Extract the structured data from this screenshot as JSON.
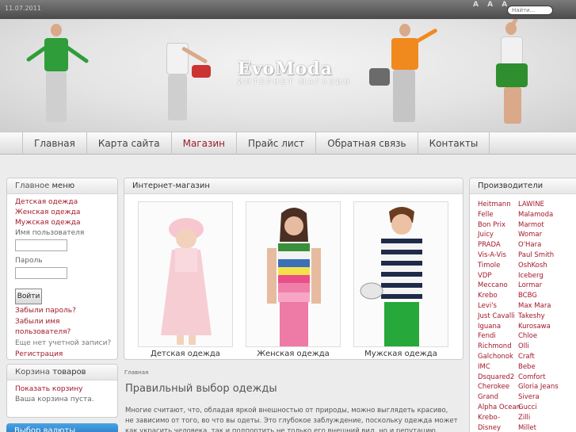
{
  "topbar": {
    "date": "11.07.2011",
    "font_sizes": "A A A",
    "search_placeholder": "Найти..."
  },
  "logo": {
    "line1": "EvoModa",
    "line2": "ИНТЕРНЕТ МАГАЗИН"
  },
  "nav": {
    "items": [
      "Главная",
      "Карта сайта",
      "Магазин",
      "Прайс лист",
      "Обратная связь",
      "Контакты"
    ],
    "active_index": 2
  },
  "main_menu": {
    "title_light": "Главное",
    "title_bold": "меню",
    "links": [
      "Детская одежда",
      "Женская одежда",
      "Мужская одежда"
    ],
    "username_label": "Имя пользователя",
    "password_label": "Пароль",
    "login_button": "Войти",
    "forgot_password": "Забыли пароль?",
    "forgot_username": "Забыли имя пользователя?",
    "no_account": "Еще нет учетной записи?",
    "register": "Регистрация"
  },
  "cart": {
    "title_light": "Корзина",
    "title_bold": "товаров",
    "show_cart": "Показать корзину",
    "empty": "Ваша корзина пуста."
  },
  "currency": {
    "title": "Выбор валюты"
  },
  "shop": {
    "title": "Интернет-магазин",
    "categories": [
      "Детская одежда",
      "Женская одежда",
      "Мужская одежда"
    ]
  },
  "article": {
    "breadcrumb": "Главная",
    "title": "Правильный выбор одежды",
    "text": "Многие считают, что, обладая яркой внешностью от природы, можно выглядеть красиво, не зависимо от того, во что вы одеты. Это глубокое заблуждение, поскольку одежда может как украсить человека, так и подпортить не только его внешний вид, но и репутацию. Поэтому к выбору одежды нужно"
  },
  "brands": {
    "title": "Производители",
    "col1": [
      "Heitmann",
      "Felle",
      "Bon Prix",
      "Juicy",
      "PRADA",
      "Vis-A-Vis",
      "Timole",
      "VDP",
      "Meccano",
      "Krebo",
      "Levi's",
      "Just Cavalli",
      "Iguana",
      "Fendi",
      "Richmond",
      "Galchonok",
      "IMC",
      "Dsquared2",
      "Cherokee",
      "Grand",
      "Alpha Ocean",
      "Krebo-",
      "Disney"
    ],
    "col2": [
      "LAWINE",
      "Malamoda",
      "Marmot",
      "Womar",
      "O'Hara",
      "Paul Smith",
      "OshKosh",
      "Iceberg",
      "Lormar",
      "BCBG",
      "Max Mara",
      "Takeshy",
      "Kurosawa",
      "Chloe",
      "Olli",
      "Craft",
      "Bebe",
      "Comfort",
      "Gloria Jeans",
      "Sivera",
      "Gucci",
      "Zilli",
      "Millet"
    ]
  },
  "colors": {
    "accent": "#a3182a",
    "nav_active": "#9b1c2c",
    "currency_header": "#1f6fb5"
  }
}
